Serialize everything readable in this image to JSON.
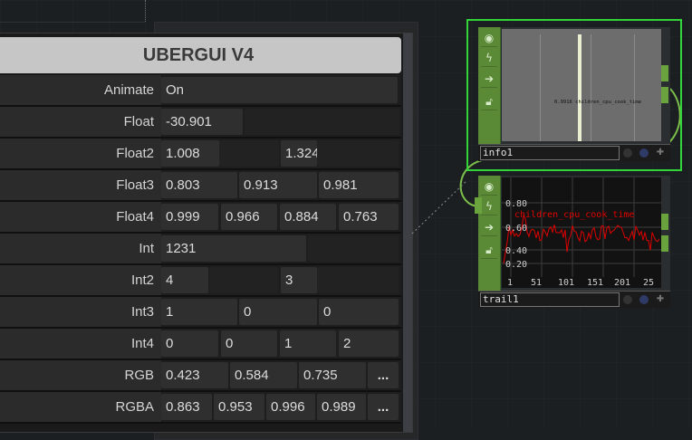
{
  "panel": {
    "title": "UBERGUI V4",
    "rows": [
      {
        "label": "Animate",
        "values": [
          "On"
        ]
      },
      {
        "label": "Float",
        "values": [
          "-30.901"
        ]
      },
      {
        "label": "Float2",
        "values": [
          "1.008",
          "1.324"
        ]
      },
      {
        "label": "Float3",
        "values": [
          "0.803",
          "0.913",
          "0.981"
        ]
      },
      {
        "label": "Float4",
        "values": [
          "0.999",
          "0.966",
          "0.884",
          "0.763"
        ]
      },
      {
        "label": "Int",
        "values": [
          "1231"
        ]
      },
      {
        "label": "Int2",
        "values": [
          "4",
          "3"
        ]
      },
      {
        "label": "Int3",
        "values": [
          "1",
          "0",
          "0"
        ]
      },
      {
        "label": "Int4",
        "values": [
          "0",
          "0",
          "1",
          "2"
        ]
      },
      {
        "label": "RGB",
        "values": [
          "0.423",
          "0.584",
          "0.735"
        ],
        "more": "..."
      },
      {
        "label": "RGBA",
        "values": [
          "0.863",
          "0.953",
          "0.996",
          "0.989"
        ],
        "more": "..."
      }
    ]
  },
  "nodes": {
    "info": {
      "name": "info1",
      "readout": "0.9916 children_cpu_cook_time"
    },
    "trail": {
      "name": "trail1",
      "channel": "children_cpu_cook_time",
      "y_ticks": [
        "0.80",
        "0.60",
        "0.40",
        "0.20"
      ],
      "x_ticks": [
        "1",
        "51",
        "101",
        "151",
        "201",
        "25"
      ]
    }
  },
  "colors": {
    "selection": "#32d43a",
    "node_strip": "#5a8a36",
    "trail_line": "#e00000"
  }
}
